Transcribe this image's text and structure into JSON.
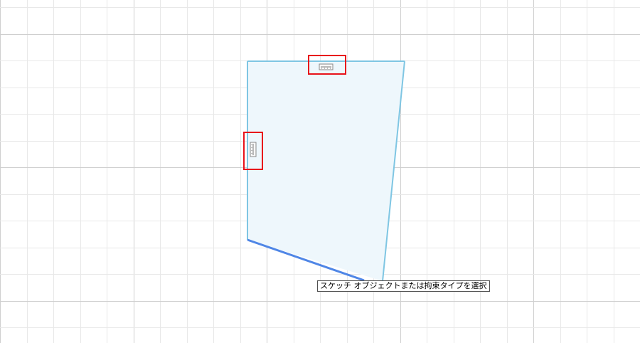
{
  "canvas": {
    "background": "#ffffff",
    "grid_major_color": "#cfcfcf",
    "grid_minor_color": "#e8e8e8"
  },
  "sketch": {
    "profile_fill": "#eef7fc",
    "profile_edge_color": "#7fc6e3",
    "selected_edge_color": "#4f86e6"
  },
  "constraints": {
    "horizontal_icon": "horizontal-constraint-icon",
    "vertical_icon": "vertical-constraint-icon",
    "highlight_color": "#e8121b"
  },
  "tooltip": {
    "text": "スケッチ オブジェクトまたは拘束タイプを選択"
  }
}
